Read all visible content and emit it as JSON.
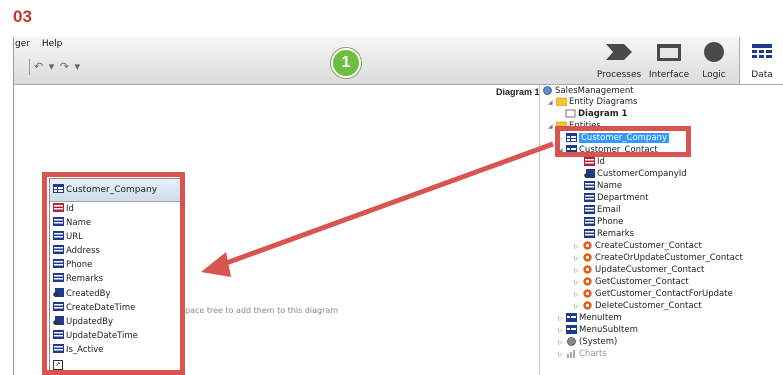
{
  "step_number": "03",
  "menu": [
    "ger",
    "Help"
  ],
  "undo_label": "↶ ▾ ↷ ▾",
  "badge": "1",
  "toolbar_items": [
    {
      "label": "Processes",
      "icon": "processes-icon"
    },
    {
      "label": "Interface",
      "icon": "interface-icon"
    },
    {
      "label": "Logic",
      "icon": "logic-icon"
    },
    {
      "label": "Data",
      "icon": "data-icon",
      "active": true
    }
  ],
  "canvas": {
    "diagram_title": "Diagram 1",
    "drag_hint": "eSpace tree to add them to this diagram"
  },
  "entity_card": {
    "title": "Customer_Company",
    "attributes": [
      "Id",
      "Name",
      "URL",
      "Address",
      "Phone",
      "Remarks",
      "CreatedBy",
      "CreateDateTime",
      "UpdatedBy",
      "UpdateDateTime",
      "Is_Active"
    ]
  },
  "tree": {
    "root": "SalesManagement",
    "entity_diagrams": "Entity Diagrams",
    "diagram1": "Diagram 1",
    "entities": "Entities",
    "customer_company": "Customer_Company",
    "customer_contact": "Customer_Contact",
    "contact_attributes": [
      "Id",
      "CustomerCompanyId",
      "Name",
      "Department",
      "Email",
      "Phone",
      "Remarks"
    ],
    "contact_actions": [
      "CreateCustomer_Contact",
      "CreateOrUpdateCustomer_Contact",
      "UpdateCustomer_Contact",
      "GetCustomer_Contact",
      "GetCustomer_ContactForUpdate",
      "DeleteCustomer_Contact"
    ],
    "menu_item": "MenuItem",
    "menu_sub_item": "MenuSubItem",
    "system": "(System)",
    "charts": "Charts"
  },
  "colors": {
    "highlight": "#d9534f",
    "selection": "#3399ff",
    "step_number": "#c0392b",
    "badge": "#6cbf3f"
  }
}
